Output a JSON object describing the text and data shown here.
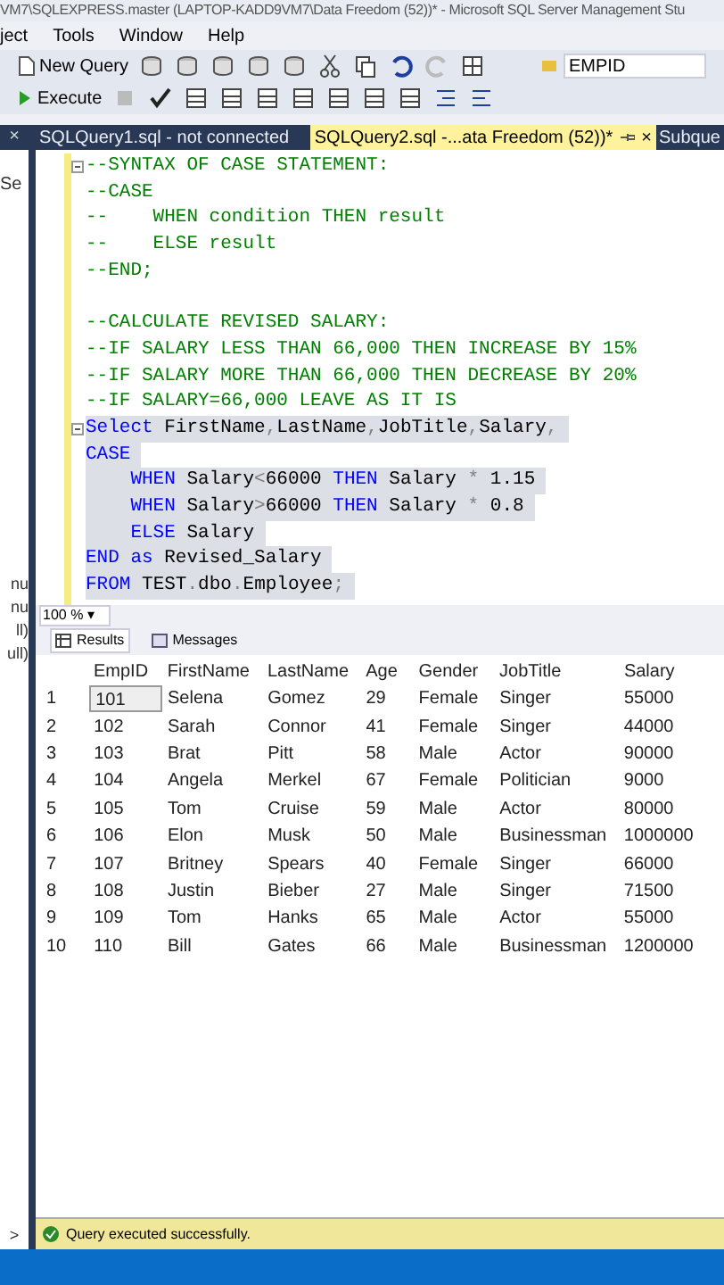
{
  "window": {
    "title": "VM7\\SQLEXPRESS.master (LAPTOP-KADD9VM7\\Data Freedom (52))* - Microsoft SQL Server Management Stu"
  },
  "menu": [
    "ject",
    "Tools",
    "Window",
    "Help"
  ],
  "toolbar": {
    "new_query": "New Query",
    "execute": "Execute",
    "find_field": "EMPID"
  },
  "sidebar": {
    "fragments": [
      "Se",
      "nu",
      "nu",
      "ll)",
      "ull)"
    ],
    "close": "×"
  },
  "tabs": [
    {
      "label": "SQLQuery1.sql - not connected",
      "selected": false
    },
    {
      "label": "SQLQuery2.sql -...ata Freedom (52))*",
      "selected": true
    },
    {
      "label": "Subque",
      "selected": false
    }
  ],
  "tab_close": "×",
  "editor": {
    "lines": [
      {
        "highlighted": false,
        "collapsible": true,
        "tokens": [
          {
            "text": "--SYNTAX OF CASE STATEMENT:",
            "kind": "comment"
          }
        ]
      },
      {
        "highlighted": false,
        "collapsible": false,
        "tokens": [
          {
            "text": "--CASE",
            "kind": "comment"
          }
        ]
      },
      {
        "highlighted": false,
        "collapsible": false,
        "tokens": [
          {
            "text": "--    WHEN condition THEN result",
            "kind": "comment"
          }
        ]
      },
      {
        "highlighted": false,
        "collapsible": false,
        "tokens": [
          {
            "text": "--    ELSE result",
            "kind": "comment"
          }
        ]
      },
      {
        "highlighted": false,
        "collapsible": false,
        "tokens": [
          {
            "text": "--END;",
            "kind": "comment"
          }
        ]
      },
      {
        "collapsible": false
      },
      {
        "highlighted": false,
        "collapsible": false,
        "tokens": [
          {
            "text": "--CALCULATE REVISED SALARY:",
            "kind": "comment"
          }
        ]
      },
      {
        "highlighted": false,
        "collapsible": false,
        "tokens": [
          {
            "text": "--IF SALARY LESS THAN 66,000 THEN INCREASE BY 15%",
            "kind": "comment"
          }
        ]
      },
      {
        "highlighted": false,
        "collapsible": false,
        "tokens": [
          {
            "text": "--IF SALARY MORE THAN 66,000 THEN DECREASE BY 20%",
            "kind": "comment"
          }
        ]
      },
      {
        "highlighted": false,
        "collapsible": false,
        "tokens": [
          {
            "text": "--IF SALARY=66,000 LEAVE AS IT IS",
            "kind": "comment"
          }
        ]
      },
      {
        "highlighted": true,
        "collapsible": true,
        "tokens": [
          {
            "text": "Select",
            "kind": "keyword"
          },
          {
            "text": " FirstName",
            "kind": "plain"
          },
          {
            "text": ",",
            "kind": "operator"
          },
          {
            "text": "LastName",
            "kind": "plain"
          },
          {
            "text": ",",
            "kind": "operator"
          },
          {
            "text": "JobTitle",
            "kind": "plain"
          },
          {
            "text": ",",
            "kind": "operator"
          },
          {
            "text": "Salary",
            "kind": "plain"
          },
          {
            "text": ",",
            "kind": "operator"
          }
        ]
      },
      {
        "highlighted": true,
        "collapsible": false,
        "tokens": [
          {
            "text": "CASE",
            "kind": "keyword"
          }
        ]
      },
      {
        "highlighted": true,
        "collapsible": false,
        "tokens": [
          {
            "text": "    WHEN",
            "kind": "keyword"
          },
          {
            "text": " Salary",
            "kind": "plain"
          },
          {
            "text": "<",
            "kind": "operator"
          },
          {
            "text": "66000 ",
            "kind": "plain"
          },
          {
            "text": "THEN",
            "kind": "keyword"
          },
          {
            "text": " Salary ",
            "kind": "plain"
          },
          {
            "text": "*",
            "kind": "operator"
          },
          {
            "text": " 1.15",
            "kind": "plain"
          }
        ]
      },
      {
        "highlighted": true,
        "collapsible": false,
        "tokens": [
          {
            "text": "    WHEN",
            "kind": "keyword"
          },
          {
            "text": " Salary",
            "kind": "plain"
          },
          {
            "text": ">",
            "kind": "operator"
          },
          {
            "text": "66000 ",
            "kind": "plain"
          },
          {
            "text": "THEN",
            "kind": "keyword"
          },
          {
            "text": " Salary ",
            "kind": "plain"
          },
          {
            "text": "*",
            "kind": "operator"
          },
          {
            "text": " 0.8",
            "kind": "plain"
          }
        ]
      },
      {
        "highlighted": true,
        "collapsible": false,
        "tokens": [
          {
            "text": "    ELSE",
            "kind": "keyword"
          },
          {
            "text": " Salary",
            "kind": "plain"
          }
        ]
      },
      {
        "highlighted": true,
        "collapsible": false,
        "tokens": [
          {
            "text": "END",
            "kind": "keyword"
          },
          {
            "text": " as",
            "kind": "keyword"
          },
          {
            "text": " Revised_Salary",
            "kind": "plain"
          }
        ]
      },
      {
        "highlighted": true,
        "collapsible": false,
        "tokens": [
          {
            "text": "FROM",
            "kind": "keyword"
          },
          {
            "text": " TEST",
            "kind": "plain"
          },
          {
            "text": ".",
            "kind": "operator"
          },
          {
            "text": "dbo",
            "kind": "plain"
          },
          {
            "text": ".",
            "kind": "operator"
          },
          {
            "text": "Employee",
            "kind": "plain"
          },
          {
            "text": ";",
            "kind": "operator"
          }
        ]
      }
    ]
  },
  "zoom": "100 %",
  "zoom_caret": "▾",
  "result_tabs": [
    {
      "label": "Results",
      "selected": true
    },
    {
      "label": "Messages",
      "selected": false
    }
  ],
  "table": {
    "columns": [
      "EmpID",
      "FirstName",
      "LastName",
      "Age",
      "Gender",
      "JobTitle",
      "Salary"
    ],
    "rows": [
      {
        "num": "1",
        "cells": [
          "101",
          "Selena",
          "Gomez",
          "29",
          "Female",
          "Singer",
          "55000"
        ],
        "selected": true
      },
      {
        "num": "2",
        "cells": [
          "102",
          "Sarah",
          "Connor",
          "41",
          "Female",
          "Singer",
          "44000"
        ],
        "selected": false
      },
      {
        "num": "3",
        "cells": [
          "103",
          "Brat",
          "Pitt",
          "58",
          "Male",
          "Actor",
          "90000"
        ],
        "selected": false
      },
      {
        "num": "4",
        "cells": [
          "104",
          "Angela",
          "Merkel",
          "67",
          "Female",
          "Politician",
          "9000"
        ],
        "selected": false
      },
      {
        "num": "5",
        "cells": [
          "105",
          "Tom",
          "Cruise",
          "59",
          "Male",
          "Actor",
          "80000"
        ],
        "selected": false
      },
      {
        "num": "6",
        "cells": [
          "106",
          "Elon",
          "Musk",
          "50",
          "Male",
          "Businessman",
          "1000000"
        ],
        "selected": false
      },
      {
        "num": "7",
        "cells": [
          "107",
          "Britney",
          "Spears",
          "40",
          "Female",
          "Singer",
          "66000"
        ],
        "selected": false
      },
      {
        "num": "8",
        "cells": [
          "108",
          "Justin",
          "Bieber",
          "27",
          "Male",
          "Singer",
          "71500"
        ],
        "selected": false
      },
      {
        "num": "9",
        "cells": [
          "109",
          "Tom",
          "Hanks",
          "65",
          "Male",
          "Actor",
          "55000"
        ],
        "selected": false
      },
      {
        "num": "10",
        "cells": [
          "110",
          "Bill",
          "Gates",
          "66",
          "Male",
          "Businessman",
          "1200000"
        ],
        "selected": false
      }
    ]
  },
  "status_bar": {
    "message": "Query executed successfully.",
    "arrow": ">"
  }
}
